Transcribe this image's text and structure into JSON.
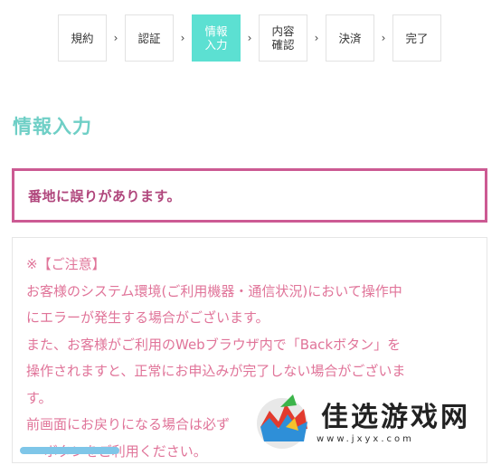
{
  "stepper": {
    "steps": [
      {
        "label": "規約",
        "active": false
      },
      {
        "label": "認証",
        "active": false
      },
      {
        "label": "情報\n入力",
        "active": true
      },
      {
        "label": "内容\n確認",
        "active": false
      },
      {
        "label": "決済",
        "active": false
      },
      {
        "label": "完了",
        "active": false
      }
    ],
    "separator": "›"
  },
  "page_title": "情報入力",
  "error_message": "番地に誤りがあります。",
  "notice": {
    "lines": [
      "※【ご注意】",
      "お客様のシステム環境(ご利用機器・通信状況)において操作中",
      "にエラーが発生する場合がございます。",
      "また、お客様がご利用のWebブラウザ内で「Backボタン」を",
      "操作されますと、正常にお申込みが完了しない場合がございま",
      "す。",
      "前画面にお戻りになる場合は必ず",
      "ー ボタンをご利用ください。"
    ]
  },
  "watermark": {
    "title": "佳选游戏网",
    "url": "www.jxyx.com"
  },
  "colors": {
    "accent_teal": "#5ce0d2",
    "error_border": "#cc5a93",
    "notice_text": "#e07499"
  }
}
